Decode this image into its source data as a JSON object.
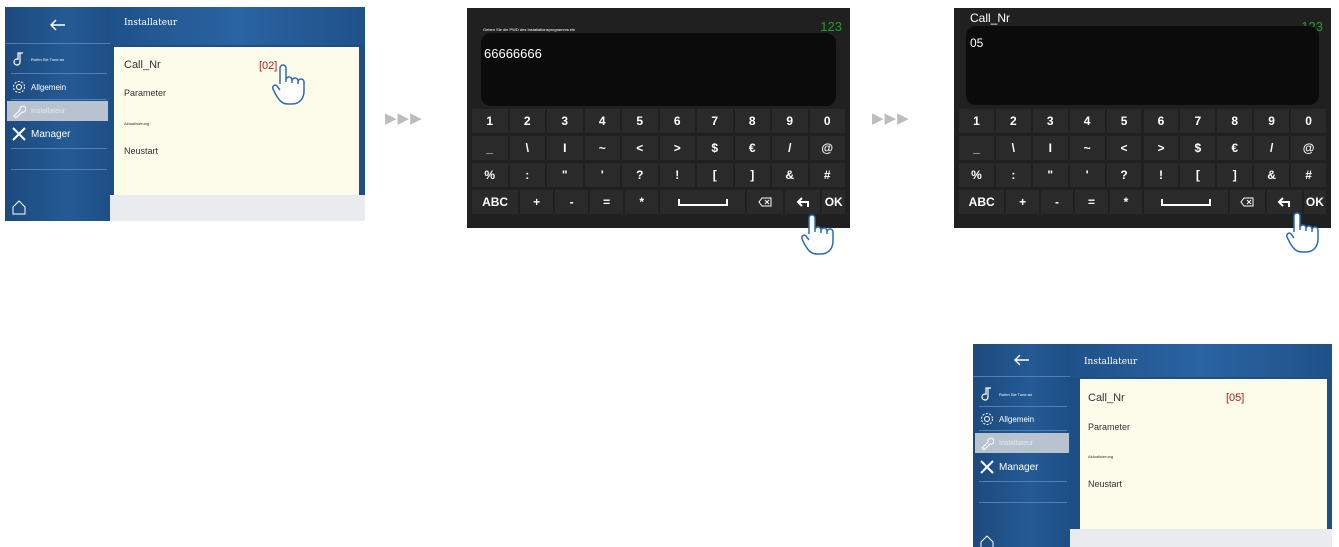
{
  "settings_before": {
    "header_title": "Installateur",
    "menu": [
      {
        "label": "Rufen Sie Tune an",
        "icon": "music-note-icon"
      },
      {
        "label": "Allgemein",
        "icon": "gear-icon"
      },
      {
        "label": "Installateur",
        "icon": "wrench-icon"
      },
      {
        "label": "Manager",
        "icon": "tools-icon"
      }
    ],
    "rows": {
      "call_nr_label": "Call_Nr",
      "call_nr_value": "[02]",
      "parameter_label": "Parameter",
      "update_label": "Aktualisierung",
      "restart_label": "Neustart"
    }
  },
  "arrows": "▶▶▶",
  "password_keyboard": {
    "prompt": "Geben Sie die PWD des Installationsprogramms ein",
    "input_text": "66666666",
    "mode_badge": "123",
    "ok_label": "OK"
  },
  "callnr_keyboard": {
    "title": "Call_Nr",
    "input_text": "05",
    "mode_badge": "123",
    "ok_label": "OK"
  },
  "keyboard_rows": [
    [
      "1",
      "2",
      "3",
      "4",
      "5",
      "6",
      "7",
      "8",
      "9",
      "0"
    ],
    [
      "_",
      "\\",
      "I",
      "~",
      "<",
      ">",
      "$",
      "€",
      "/",
      "@"
    ],
    [
      "%",
      ":",
      "\"",
      "'",
      "?",
      "!",
      "[",
      "]",
      "&",
      "#"
    ]
  ],
  "keyboard_bottom": [
    "ABC",
    "+",
    "-",
    "=",
    "*"
  ],
  "settings_after": {
    "header_title": "Installateur",
    "menu": [
      {
        "label": "Rufen Sie Tune an",
        "icon": "music-note-icon"
      },
      {
        "label": "Allgemein",
        "icon": "gear-icon"
      },
      {
        "label": "Installateur",
        "icon": "wrench-icon"
      },
      {
        "label": "Manager",
        "icon": "tools-icon"
      }
    ],
    "rows": {
      "call_nr_label": "Call_Nr",
      "call_nr_value": "[05]",
      "parameter_label": "Parameter",
      "update_label": "Aktualisierung",
      "restart_label": "Neustart"
    }
  },
  "colors": {
    "sidebar_blue": "#245a94",
    "panel_cream": "#fdfbea",
    "value_red": "#b01c1c",
    "badge_green": "#1ea02c",
    "keyboard_dark": "#202020"
  }
}
